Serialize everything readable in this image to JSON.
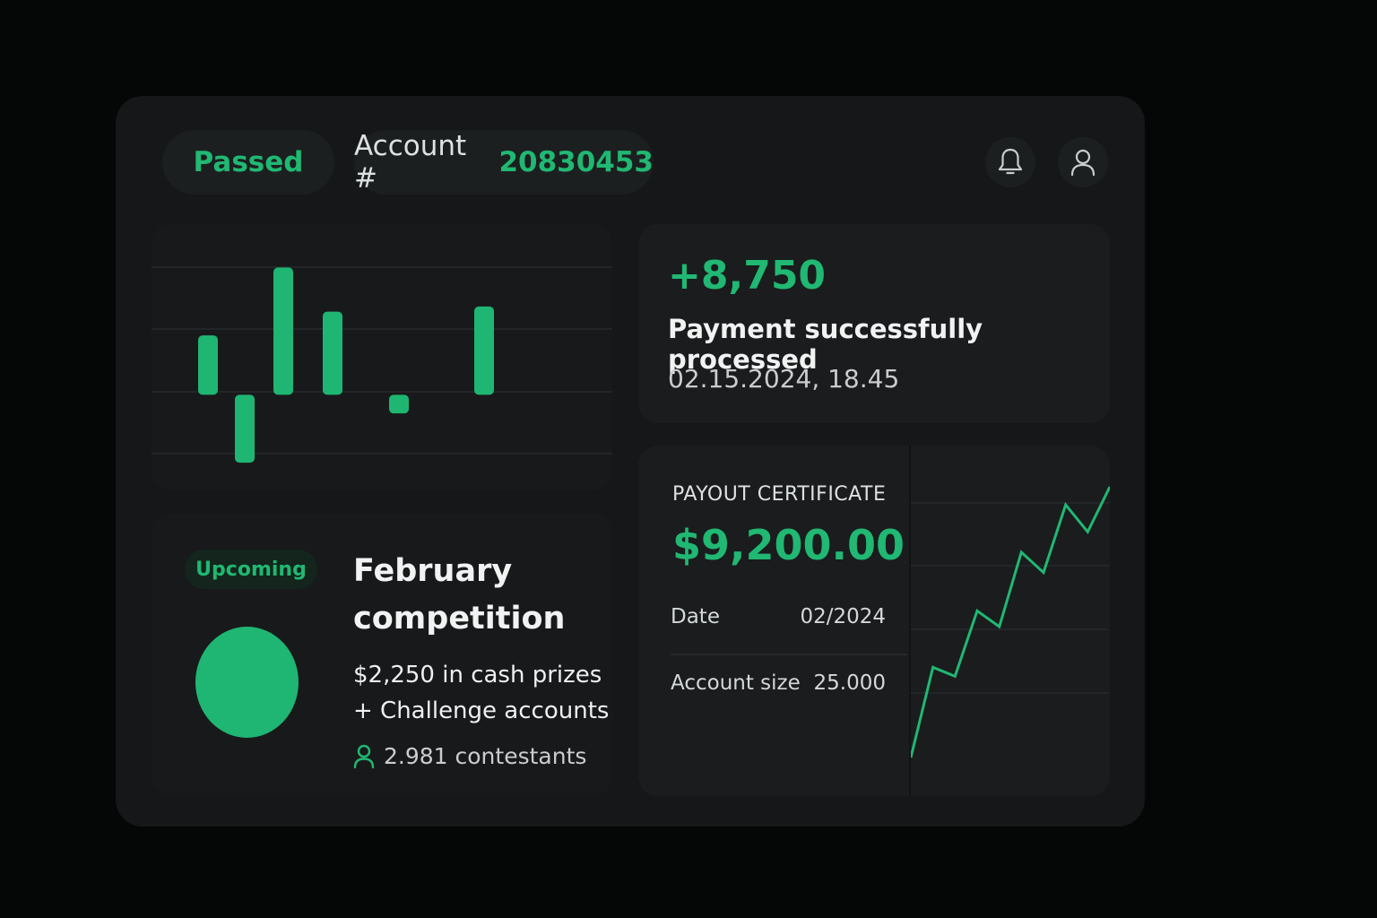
{
  "header": {
    "status": "Passed",
    "account_label": "Account #",
    "account_number": "20830453",
    "icons": [
      "bell-icon",
      "user-icon"
    ]
  },
  "payment": {
    "amount": "+8,750",
    "title": "Payment successfully processed",
    "datetime": "02.15.2024, 18.45"
  },
  "competition": {
    "badge": "Upcoming",
    "title": "February competition",
    "prize_line1": "$2,250 in cash prizes",
    "prize_line2": "+ Challenge accounts",
    "contestants": "2.981 contestants"
  },
  "certificate": {
    "label": "PAYOUT CERTIFICATE",
    "amount": "$9,200.00",
    "date_label": "Date",
    "date_value": "02/2024",
    "size_label": "Account size",
    "size_value": "25.000"
  },
  "colors": {
    "accent": "#20b872",
    "background": "#050606",
    "panel": "#151718",
    "card": "#1a1c1e"
  },
  "chart_data": [
    {
      "type": "bar",
      "title": "",
      "values": [
        3.5,
        -4.0,
        7.5,
        4.9,
        -1.1,
        5.2
      ],
      "ylim": [
        -5,
        9
      ],
      "grid": true
    },
    {
      "type": "line",
      "title": "",
      "values": [
        0,
        4,
        3.6,
        6.5,
        5.8,
        9.1,
        8.2,
        11.2,
        10.0,
        12.0
      ],
      "ylim": [
        0,
        12
      ],
      "grid": true
    }
  ]
}
